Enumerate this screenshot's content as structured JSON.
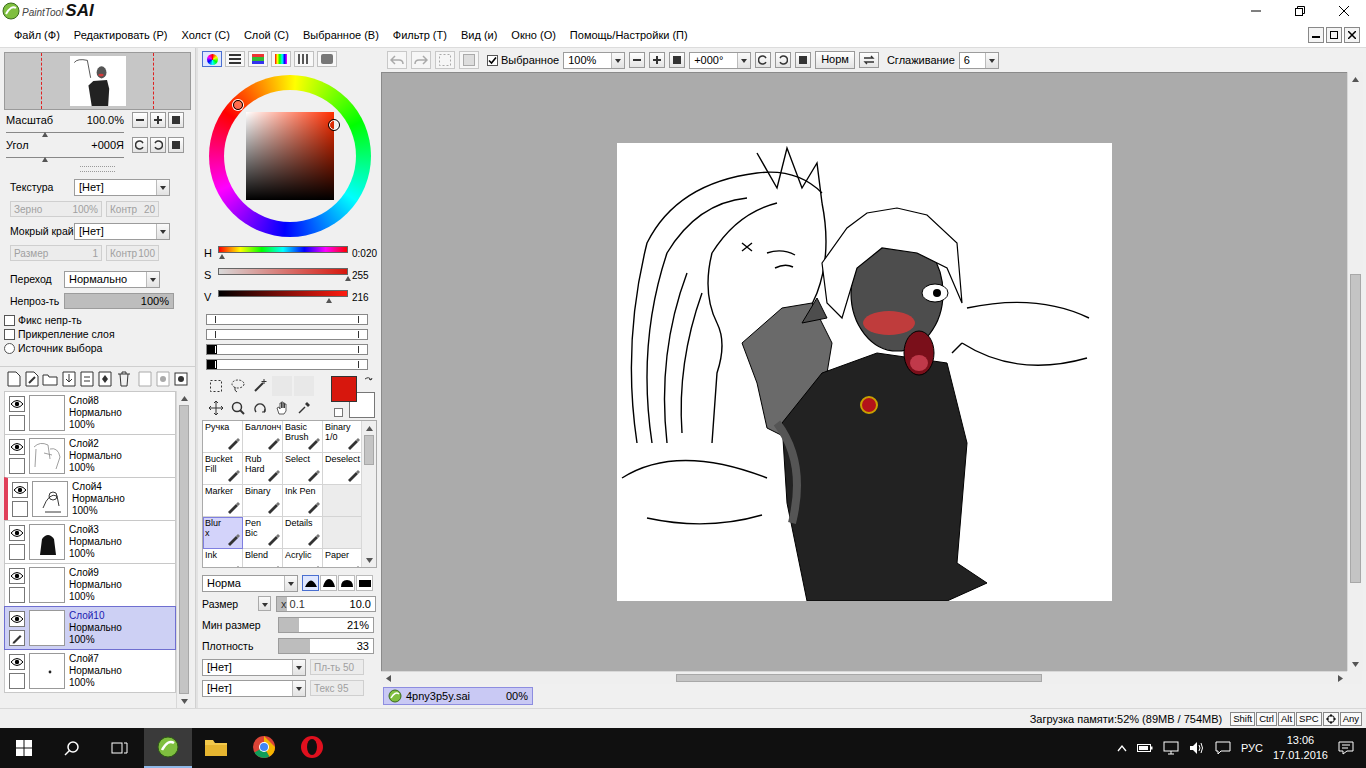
{
  "window": {
    "logo_prefix": "PaintTool",
    "logo_main": "SAI"
  },
  "menu": {
    "items": [
      "Файл (Ф)",
      "Редактировать (Р)",
      "Холст (С)",
      "Слой (С)",
      "Выбранное (В)",
      "Фильтр (Т)",
      "Вид (и)",
      "Окно (О)",
      "Помощь/Настройки (П)"
    ]
  },
  "view": {
    "zoom": {
      "label": "Масштаб",
      "value": "100.0%",
      "level": 0.33
    },
    "angle": {
      "label": "Угол",
      "value": "+000Я",
      "level": 0.33
    }
  },
  "brush_texture": {
    "texture": {
      "label": "Текстура",
      "value": "[Нет]"
    },
    "grain": {
      "label": "Зерно",
      "value": "100%",
      "disabled": true
    },
    "grain_contrast": {
      "label": "Контр",
      "value": "20",
      "disabled": true
    },
    "wet_edge": {
      "label": "Мокрый край",
      "value": "[Нет]"
    },
    "wet_size": {
      "label": "Размер",
      "value": "1",
      "disabled": true
    },
    "wet_contrast": {
      "label": "Контр",
      "value": "100",
      "disabled": true
    }
  },
  "layer_props": {
    "blend": {
      "label": "Переход",
      "value": "Нормально"
    },
    "opacity": {
      "label": "Непроз-ть",
      "value": "100%",
      "level": 1
    },
    "options": [
      {
        "label": "Фикс непр-ть",
        "kind": "checkbox",
        "checked": false
      },
      {
        "label": "Прикрепление слоя",
        "kind": "checkbox",
        "checked": false
      },
      {
        "label": "Источник выбора",
        "kind": "radio",
        "checked": false
      }
    ]
  },
  "layers": [
    {
      "name": "Слой8",
      "mode": "Нормально",
      "opacity": "100%",
      "visible": true,
      "selected": false,
      "marked": false,
      "kind": "blank"
    },
    {
      "name": "Слой2",
      "mode": "Нормально",
      "opacity": "100%",
      "visible": true,
      "selected": false,
      "marked": false,
      "kind": "sketch"
    },
    {
      "name": "Слой4",
      "mode": "Нормально",
      "opacity": "100%",
      "visible": true,
      "selected": false,
      "marked": true,
      "kind": "lineart"
    },
    {
      "name": "Слой3",
      "mode": "Нормально",
      "opacity": "100%",
      "visible": true,
      "selected": false,
      "marked": false,
      "kind": "silhouette"
    },
    {
      "name": "Слой9",
      "mode": "Нормально",
      "opacity": "100%",
      "visible": true,
      "selected": false,
      "marked": false,
      "kind": "blank"
    },
    {
      "name": "Слой10",
      "mode": "Нормально",
      "opacity": "100%",
      "visible": true,
      "selected": true,
      "marked": false,
      "kind": "blank"
    },
    {
      "name": "Слой7",
      "mode": "Нормально",
      "opacity": "100%",
      "visible": true,
      "selected": false,
      "marked": false,
      "kind": "dot"
    }
  ],
  "color": {
    "tabs": [
      {
        "selected": true
      },
      {
        "selected": false
      },
      {
        "selected": false
      },
      {
        "selected": false
      },
      {
        "selected": false
      },
      {
        "selected": false
      }
    ],
    "hsv": [
      {
        "label": "H",
        "value": "0:020",
        "level": 0.03
      },
      {
        "label": "S",
        "value": "255",
        "level": 1
      },
      {
        "label": "V",
        "value": "216",
        "level": 0.85
      }
    ],
    "primary_color": "#d7170d",
    "secondary_color": "#ffffff"
  },
  "brushes": [
    {
      "kind": "brush",
      "lines": [
        "Ручка"
      ],
      "selected": false
    },
    {
      "kind": "brush",
      "lines": [
        "Баллонч"
      ],
      "selected": false
    },
    {
      "kind": "brush",
      "lines": [
        "Basic",
        "Brush"
      ],
      "selected": false
    },
    {
      "kind": "brush",
      "lines": [
        "Binary",
        "1/0"
      ],
      "selected": false
    },
    {
      "kind": "brush",
      "lines": [
        "Bucket",
        "Fill"
      ],
      "selected": false
    },
    {
      "kind": "brush",
      "lines": [
        "Rub",
        "Hard"
      ],
      "selected": false
    },
    {
      "kind": "brush",
      "lines": [
        "Select"
      ],
      "selected": false
    },
    {
      "kind": "brush",
      "lines": [
        "Deselect"
      ],
      "selected": false
    },
    {
      "kind": "brush",
      "lines": [
        "Marker"
      ],
      "selected": false
    },
    {
      "kind": "brush",
      "lines": [
        "Binary"
      ],
      "selected": false
    },
    {
      "kind": "brush",
      "lines": [
        "Ink Pen"
      ],
      "selected": false
    },
    {
      "kind": "empty",
      "lines": [],
      "selected": false
    },
    {
      "kind": "brush",
      "lines": [
        "Blur",
        "x"
      ],
      "selected": true
    },
    {
      "kind": "brush",
      "lines": [
        "Pen",
        "Bic"
      ],
      "selected": false
    },
    {
      "kind": "brush",
      "lines": [
        "Details"
      ],
      "selected": false
    },
    {
      "kind": "empty",
      "lines": [],
      "selected": false
    },
    {
      "kind": "brush",
      "lines": [
        "Ink"
      ],
      "selected": false
    },
    {
      "kind": "brush",
      "lines": [
        "Blend"
      ],
      "selected": false
    },
    {
      "kind": "brush",
      "lines": [
        "Acrylic"
      ],
      "selected": false
    },
    {
      "kind": "brush",
      "lines": [
        "Paper"
      ],
      "selected": false
    }
  ],
  "brush_settings": {
    "mode": "Норма",
    "shapes": [
      {
        "selected": true
      },
      {
        "selected": false
      },
      {
        "selected": false
      },
      {
        "selected": false
      }
    ],
    "size": {
      "label": "Размер",
      "multiplier": "x 0.1",
      "value": "10.0",
      "level": 0.1
    },
    "min_size": {
      "label": "Мин размер",
      "value": "21%",
      "level": 0.21
    },
    "density": {
      "label": "Плотность",
      "value": "33",
      "level": 0.33
    },
    "texture_rows": [
      {
        "value": "[Нет]",
        "label": "Пл-ть 50",
        "disabled": true
      },
      {
        "value": "[Нет]",
        "label": "Текс 95",
        "disabled": true
      }
    ]
  },
  "toolbar": {
    "selection": {
      "label": "Выбранное",
      "checked": true
    },
    "zoom": "100%",
    "angle": "+000°",
    "mode_button": "Норм",
    "smoothing": {
      "label": "Сглаживание",
      "value": "6"
    }
  },
  "scroll": {
    "h": {
      "start": 0.3,
      "size": 0.39
    },
    "v": {
      "start": 0.33,
      "size": 0.54
    }
  },
  "doc_tabs": [
    {
      "name": "4pny3p5y.sai",
      "progress": "00%",
      "selected": true
    }
  ],
  "status": {
    "memory": "Загрузка памяти:52% (89MB / 754MB)",
    "keys": [
      {
        "kind": "text",
        "label": "Shift"
      },
      {
        "kind": "text",
        "label": "Ctrl"
      },
      {
        "kind": "text",
        "label": "Alt"
      },
      {
        "kind": "text",
        "label": "SPC"
      },
      {
        "kind": "icon"
      },
      {
        "kind": "text",
        "label": "Any"
      }
    ]
  },
  "taskbar": {
    "apps": [
      {
        "kind": "sai",
        "active": true
      },
      {
        "kind": "folder",
        "active": false
      },
      {
        "kind": "chrome",
        "active": false
      },
      {
        "kind": "opera",
        "active": false
      }
    ],
    "language": "РУС",
    "time": "13:06",
    "date": "17.01.2016"
  }
}
